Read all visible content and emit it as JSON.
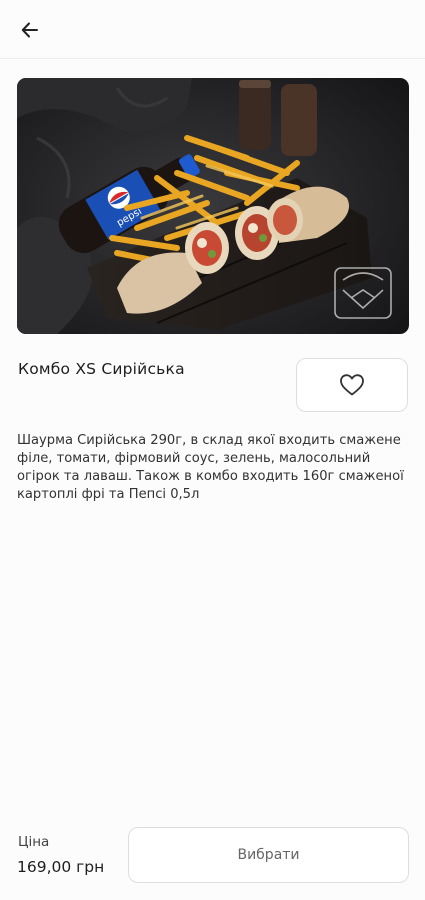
{
  "header": {
    "back_icon": "arrow-left-icon"
  },
  "product": {
    "title": "Комбо XS Сирійська",
    "favorite_icon": "heart-outline-icon",
    "description": "Шаурма Сирійська 290г, в склад якої входить смажене філе, томати, фірмовий соус, зелень, малосольний огірок та лаваш. Також в  комбо входить 160г смаженої картоплі фрі та Пепсі 0,5л",
    "image": {
      "bottle_logo": "pepsi",
      "bottle_brand_color": "#1a4fb5",
      "watermark": "restaurant-logo"
    }
  },
  "footer": {
    "price_label": "Ціна",
    "price_value": "169,00 грн",
    "select_label": "Вибрати"
  }
}
